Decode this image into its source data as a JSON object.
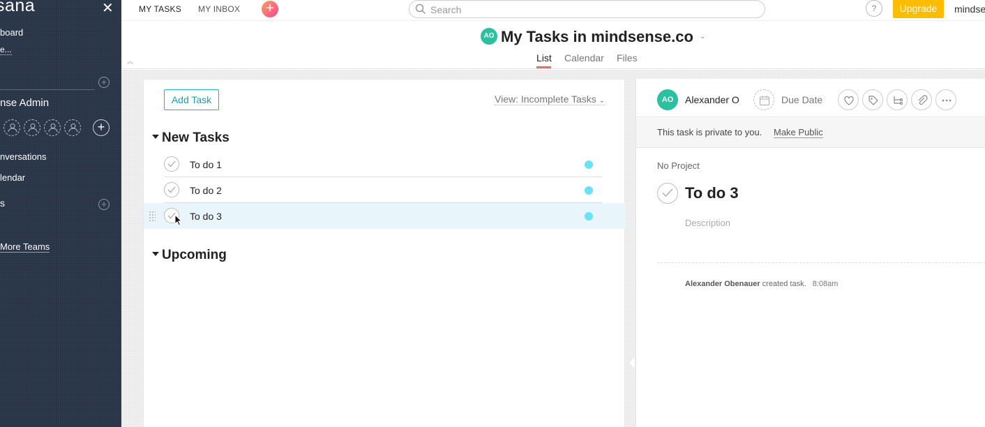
{
  "sidebar": {
    "logo": "sana",
    "items": {
      "dashboard": "board",
      "customize": "e...",
      "team_name": "nse Admin",
      "conversations": "nversations",
      "calendar": "lendar",
      "projects": "s",
      "more_teams": "More Teams"
    }
  },
  "topbar": {
    "tab_my_tasks": "MY TASKS",
    "tab_my_inbox": "MY INBOX",
    "search_placeholder": "Search",
    "help": "?",
    "upgrade": "Upgrade",
    "org": "mindse"
  },
  "header": {
    "avatar_initials": "AO",
    "title": "My Tasks in mindsense.co",
    "tabs": [
      "List",
      "Calendar",
      "Files"
    ]
  },
  "list": {
    "add_task": "Add Task",
    "view": "View: Incomplete Tasks",
    "sections": [
      "New Tasks",
      "Upcoming"
    ],
    "tasks": [
      {
        "name": "To do 1"
      },
      {
        "name": "To do 2"
      },
      {
        "name": "To do 3"
      }
    ]
  },
  "detail": {
    "assignee_initials": "AO",
    "assignee": "Alexander O",
    "due_date": "Due Date",
    "private_text": "This task is private to you.",
    "make_public": "Make Public",
    "project": "No Project",
    "title": "To do 3",
    "description_placeholder": "Description",
    "activity_user": "Alexander Obenauer",
    "activity_action": "created task.",
    "activity_time": "8:08am"
  },
  "colors": {
    "sidebar_bg": "#273347",
    "accent_teal": "#1fb5c9",
    "upgrade": "#fcbd01",
    "avatar": "#2bc0a0",
    "tab_underline": "#f06a6a",
    "task_dot": "#6be1f8"
  }
}
